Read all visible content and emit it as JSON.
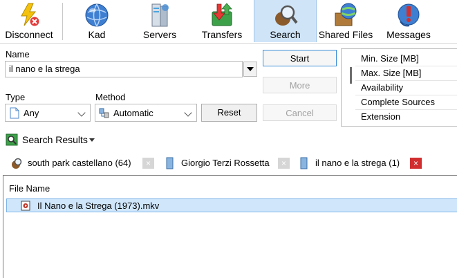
{
  "toolbar": {
    "disconnect": "Disconnect",
    "kad": "Kad",
    "servers": "Servers",
    "transfers": "Transfers",
    "search": "Search",
    "shared_files": "Shared Files",
    "messages": "Messages"
  },
  "search_form": {
    "name_label": "Name",
    "name_value": "il nano e la strega",
    "type_label": "Type",
    "type_value": "Any",
    "method_label": "Method",
    "method_value": "Automatic",
    "start_button": "Start",
    "more_button": "More",
    "cancel_button": "Cancel",
    "reset_button": "Reset"
  },
  "options": {
    "items": [
      "Min. Size [MB]",
      "Max. Size [MB]",
      "Availability",
      "Complete Sources",
      "Extension"
    ]
  },
  "results": {
    "title": "Search Results",
    "tabs": [
      {
        "label": "south park castellano (64)"
      },
      {
        "label": "Giorgio Terzi Rossetta"
      },
      {
        "label": "il nano e la strega (1)"
      }
    ],
    "close_glyph": "×",
    "column_file_name": "File Name",
    "rows": [
      {
        "file_name": "Il Nano e la Strega (1973).mkv"
      }
    ]
  },
  "colors": {
    "active_tab_bg": "#cfe4f7",
    "selection_bg": "#cfe6fb",
    "close_active": "#d12f2f",
    "primary_border": "#3a8ed6"
  }
}
